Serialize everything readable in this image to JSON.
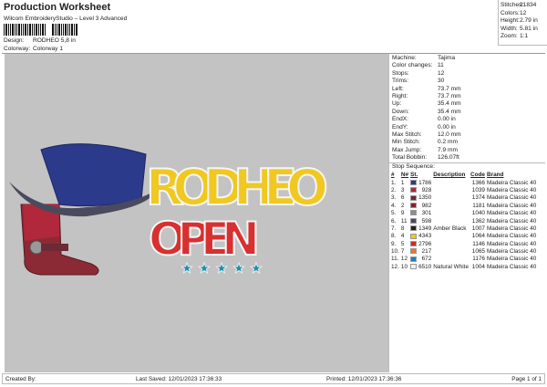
{
  "header": {
    "title": "Production Worksheet",
    "subtitle": "Wilcom EmbroideryStudio – Level 3 Advanced",
    "design_label": "Design:",
    "design_value": "RODHEO 5,8 in",
    "colorway_label": "Colorway:",
    "colorway_value": "Colorway 1"
  },
  "stats": [
    {
      "label": "Stitches:",
      "value": "21834"
    },
    {
      "label": "Colors:",
      "value": "12"
    },
    {
      "label": "Height:",
      "value": "2.79 in"
    },
    {
      "label": "Width:",
      "value": "5.81 in"
    },
    {
      "label": "Zoom:",
      "value": "1:1"
    }
  ],
  "machine": [
    {
      "label": "Machine:",
      "value": "Tajima"
    },
    {
      "label": "Color changes:",
      "value": "11"
    },
    {
      "label": "Stops:",
      "value": "12"
    },
    {
      "label": "Trims:",
      "value": "30"
    },
    {
      "label": "Left:",
      "value": "73.7 mm"
    },
    {
      "label": "Right:",
      "value": "73.7 mm"
    },
    {
      "label": "Up:",
      "value": "35.4 mm"
    },
    {
      "label": "Down:",
      "value": "35.4 mm"
    },
    {
      "label": "EndX:",
      "value": "0.00 in"
    },
    {
      "label": "EndY:",
      "value": "0.00 in"
    },
    {
      "label": "Max Stitch:",
      "value": "12.0 mm"
    },
    {
      "label": "Min Stitch:",
      "value": "0.2 mm"
    },
    {
      "label": "Max Jump:",
      "value": "7.9 mm"
    },
    {
      "label": "Total Bobbin:",
      "value": "126.07ft"
    }
  ],
  "stop_sequence": {
    "title": "Stop Sequence:",
    "headers": [
      "#",
      "N#",
      "St.",
      "Description",
      "Code",
      "Brand"
    ],
    "rows": [
      {
        "n": "1.",
        "nn": "1",
        "color": "#2b3a8a",
        "st": "1786",
        "desc": "",
        "code": "1366",
        "brand": "Madeira Classic 40"
      },
      {
        "n": "2.",
        "nn": "3",
        "color": "#b0283a",
        "st": "928",
        "desc": "",
        "code": "1039",
        "brand": "Madeira Classic 40"
      },
      {
        "n": "3.",
        "nn": "6",
        "color": "#6b2a35",
        "st": "1350",
        "desc": "",
        "code": "1374",
        "brand": "Madeira Classic 40"
      },
      {
        "n": "4.",
        "nn": "2",
        "color": "#8b1f2e",
        "st": "982",
        "desc": "",
        "code": "1181",
        "brand": "Madeira Classic 40"
      },
      {
        "n": "5.",
        "nn": "9",
        "color": "#8c8c8c",
        "st": "301",
        "desc": "",
        "code": "1040",
        "brand": "Madeira Classic 40"
      },
      {
        "n": "6.",
        "nn": "11",
        "color": "#4a4a5e",
        "st": "598",
        "desc": "",
        "code": "1362",
        "brand": "Madeira Classic 40"
      },
      {
        "n": "7.",
        "nn": "8",
        "color": "#222222",
        "st": "1349",
        "desc": "Amber Black",
        "code": "1007",
        "brand": "Madeira Classic 40"
      },
      {
        "n": "8.",
        "nn": "4",
        "color": "#f5c518",
        "st": "4343",
        "desc": "",
        "code": "1064",
        "brand": "Madeira Classic 40"
      },
      {
        "n": "9.",
        "nn": "5",
        "color": "#d62828",
        "st": "2796",
        "desc": "",
        "code": "1146",
        "brand": "Madeira Classic 40"
      },
      {
        "n": "10.",
        "nn": "7",
        "color": "#e87a1e",
        "st": "217",
        "desc": "",
        "code": "1065",
        "brand": "Madeira Classic 40"
      },
      {
        "n": "11.",
        "nn": "12",
        "color": "#1a80c0",
        "st": "672",
        "desc": "",
        "code": "1176",
        "brand": "Madeira Classic 40"
      },
      {
        "n": "12.",
        "nn": "10",
        "color": "#eeeeee",
        "st": "6510",
        "desc": "Natural White",
        "code": "1004",
        "brand": "Madeira Classic 40"
      }
    ]
  },
  "artwork": {
    "line1": "RODHEO",
    "line2": "OPEN"
  },
  "footer": {
    "created": "Created By:",
    "saved": "Last Saved: 12/01/2023 17:36:33",
    "printed": "Printed: 12/01/2023 17:36:36",
    "page": "Page 1 of 1"
  }
}
